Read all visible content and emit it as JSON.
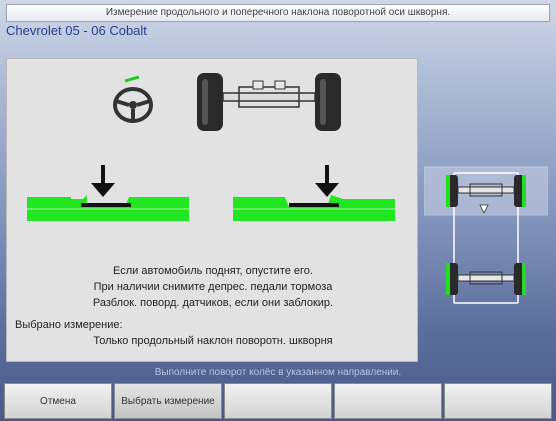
{
  "window": {
    "title": "Измерение продольного и поперечного наклона поворотной оси шкворня."
  },
  "vehicle": {
    "label": "Chevrolet 05 - 06 Cobalt"
  },
  "instructions": {
    "line1": "Если автомобиль поднят, опустите его.",
    "line2": "При наличии снимите депрес. педали тормоза",
    "line3": "Разблок. поворд. датчиков, если они заблокир.",
    "selected_label": "Выбрано измерение:",
    "selected_value": "Только продольный наклон поворотн. шкворня"
  },
  "status": {
    "text": "Выполните поворот колёс в указанном направлении."
  },
  "buttons": {
    "cancel": "Отмена",
    "select_measurement": "Выбрать измерение",
    "btn3": "",
    "btn4": "",
    "btn5": ""
  },
  "colors": {
    "ramp_green": "#22e622",
    "arrow_black": "#111111",
    "vehicle_text": "#2a3f8f"
  },
  "icons": {
    "steering": "steering-wheel-icon",
    "axle": "axle-wheels-icon",
    "arrow": "down-arrow-icon",
    "diagram": "vehicle-top-view-icon"
  }
}
